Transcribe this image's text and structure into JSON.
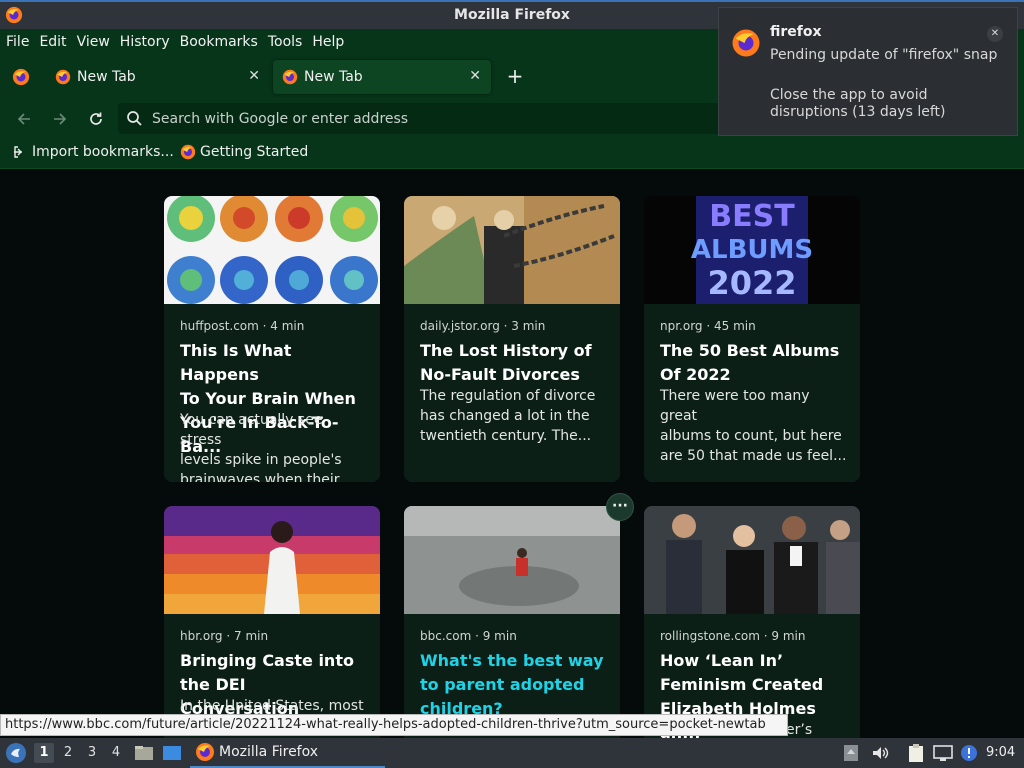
{
  "window": {
    "title": "Mozilla Firefox"
  },
  "menu": [
    "File",
    "Edit",
    "View",
    "History",
    "Bookmarks",
    "Tools",
    "Help"
  ],
  "tabs": [
    {
      "label": "New Tab",
      "active": false
    },
    {
      "label": "New Tab",
      "active": true
    }
  ],
  "urlbar": {
    "placeholder": "Search with Google or enter address"
  },
  "bookmarks": [
    {
      "label": "Import bookmarks...",
      "icon": "import-icon"
    },
    {
      "label": "Getting Started",
      "icon": "firefox-icon"
    }
  ],
  "cards": [
    {
      "source": "huffpost.com · 4 min",
      "title_lines": [
        "This Is What Happens",
        "To Your Brain When",
        "You're In Back-To-Ba..."
      ],
      "excerpt_lines": [
        "You can actually see stress",
        "levels spike in people's",
        "brainwaves when their wo..."
      ]
    },
    {
      "source": "daily.jstor.org · 3 min",
      "title_lines": [
        "The Lost History of",
        "No-Fault Divorces"
      ],
      "excerpt_lines": [
        "The regulation of divorce",
        "has changed a lot in the",
        "twentieth century. The..."
      ]
    },
    {
      "source": "npr.org · 45 min",
      "title_lines": [
        "The 50 Best Albums",
        "Of 2022"
      ],
      "excerpt_lines": [
        "There were too many great",
        "albums to count, but here",
        "are 50 that made us feel..."
      ],
      "thumb_text": [
        "BEST",
        "ALBUMS",
        "2022"
      ]
    },
    {
      "source": "hbr.org · 7 min",
      "title_lines": [
        "Bringing Caste into",
        "the DEI Conversation"
      ],
      "excerpt_lines": [
        "In the United States, most"
      ]
    },
    {
      "source": "bbc.com · 9 min",
      "title_lines": [
        "What's the best way",
        "to parent adopted",
        "children?"
      ],
      "excerpt_lines": []
    },
    {
      "source": "rollingstone.com · 9 min",
      "title_lines": [
        "How ‘Lean In’",
        "Feminism Created",
        "Elizabeth Holmes an..."
      ],
      "excerpt_lines": [
        "er’s"
      ]
    }
  ],
  "status_url": "https://www.bbc.com/future/article/20221124-what-really-helps-adopted-children-thrive?utm_source=pocket-newtab",
  "notification": {
    "app": "firefox",
    "line1": "Pending update of \"firefox\" snap",
    "line2": "Close the app to avoid disruptions (13 days left)"
  },
  "taskbar": {
    "workspaces": [
      "1",
      "2",
      "3",
      "4"
    ],
    "task_label": "Mozilla Firefox",
    "clock": "9:04"
  },
  "colors": {
    "chrome_green": "#07351a",
    "accent_link": "#1fd3e6",
    "titlebar": "#2f343a"
  }
}
